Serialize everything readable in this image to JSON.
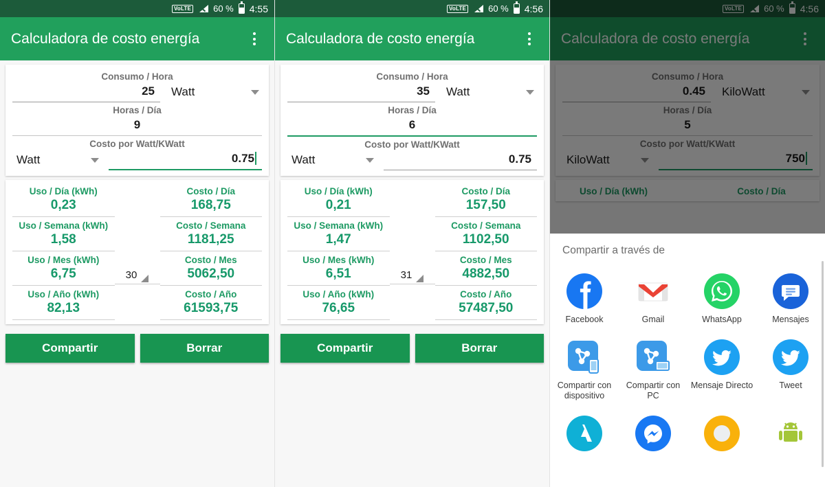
{
  "app": {
    "title": "Calculadora de costo energía",
    "brand_green": "#21a05c",
    "status_green": "#1c5b3a",
    "result_green": "#17996a"
  },
  "statusbar": {
    "volte": "VoLTE",
    "battery_pct": "60 %",
    "time_1": "4:55",
    "time_2": "4:56",
    "time_3": "4:56"
  },
  "form_labels": {
    "consumo": "Consumo / Hora",
    "horas": "Horas / Día",
    "costo": "Costo por Watt/KWatt"
  },
  "result_labels": {
    "uso_dia": "Uso / Día (kWh)",
    "costo_dia": "Costo / Día",
    "uso_semana": "Uso / Semana (kWh)",
    "costo_semana": "Costo / Semana",
    "uso_mes": "Uso / Mes (kWh)",
    "costo_mes": "Costo / Mes",
    "uso_anio": "Uso / Año (kWh)",
    "costo_anio": "Costo / Año"
  },
  "buttons": {
    "share": "Compartir",
    "clear": "Borrar"
  },
  "panels": [
    {
      "consumo_value": "25",
      "consumo_unit": "Watt",
      "horas_value": "9",
      "costo_unit": "Watt",
      "costo_value": "0.75",
      "uso_dia": "0,23",
      "costo_dia": "168,75",
      "uso_semana": "1,58",
      "costo_semana": "1181,25",
      "uso_mes": "6,75",
      "dias_mes": "30",
      "costo_mes": "5062,50",
      "uso_anio": "82,13",
      "costo_anio": "61593,75"
    },
    {
      "consumo_value": "35",
      "consumo_unit": "Watt",
      "horas_value": "6",
      "costo_unit": "Watt",
      "costo_value": "0.75",
      "uso_dia": "0,21",
      "costo_dia": "157,50",
      "uso_semana": "1,47",
      "costo_semana": "1102,50",
      "uso_mes": "6,51",
      "dias_mes": "31",
      "costo_mes": "4882,50",
      "uso_anio": "76,65",
      "costo_anio": "57487,50"
    },
    {
      "consumo_value": "0.45",
      "consumo_unit": "KiloWatt",
      "horas_value": "5",
      "costo_unit": "KiloWatt",
      "costo_value": "750"
    }
  ],
  "share_sheet": {
    "title": "Compartir a través de",
    "apps": [
      {
        "label": "Facebook",
        "icon": "facebook-icon"
      },
      {
        "label": "Gmail",
        "icon": "gmail-icon"
      },
      {
        "label": "WhatsApp",
        "icon": "whatsapp-icon"
      },
      {
        "label": "Mensajes",
        "icon": "messages-icon"
      },
      {
        "label": "Compartir con dispositivo",
        "icon": "share-device-icon"
      },
      {
        "label": "Compartir con PC",
        "icon": "share-pc-icon"
      },
      {
        "label": "Mensaje Directo",
        "icon": "twitter-dm-icon"
      },
      {
        "label": "Tweet",
        "icon": "twitter-icon"
      },
      {
        "label": "",
        "icon": "adobe-icon"
      },
      {
        "label": "",
        "icon": "messenger-icon"
      },
      {
        "label": "",
        "icon": "amber-circle-icon"
      },
      {
        "label": "",
        "icon": "android-icon"
      }
    ]
  }
}
